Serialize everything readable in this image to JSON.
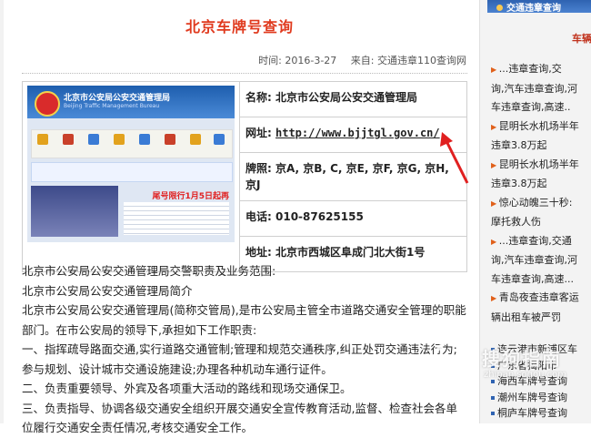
{
  "article": {
    "title": "北京车牌号查询",
    "time": "时间: 2016-3-27",
    "source": "来自: 交通违章110查询网"
  },
  "screenshot": {
    "header_name": "北京市公安局公安交通管理局",
    "header_sub": "Beijing Traffic Management Bureau",
    "red_notice": "尾号限行1月5日起再"
  },
  "info": {
    "name_label": "名称:",
    "name_value": "北京市公安局公安交通管理局",
    "site_label": "网址:",
    "site_value": "http://www.bjjtgl.gov.cn/",
    "plate_label": "牌照:",
    "plate_value": "京A, 京B, C, 京E, 京F, 京G, 京H, 京J",
    "phone_label": "电话:",
    "phone_value": "010-87625155",
    "addr_label": "地址:",
    "addr_value": "北京市西城区阜成门北大街1号"
  },
  "body": [
    "北京市公安局公安交通管理局交警职责及业务范围:",
    "北京市公安局公安交通管理局简介",
    "北京市公安局公安交通管理局(简称交管局),是市公安局主管全市道路交通安全管理的职能部门。在市公安局的领导下,承担如下工作职责:",
    "一、指挥疏导路面交通,实行道路交通管制;管理和规范交通秩序,纠正处罚交通违法行为;参与规划、设计城市交通设施建设;办理各种机动车通行证件。",
    "二、负责重要领导、外宾及各项重大活动的路线和现场交通保卫。",
    "三、负责指导、协调各级交通安全组织开展交通安全宣传教育活动,监督、检查社会各单位履行交通安全责任情况,考核交通安全工作。"
  ],
  "sidebar": {
    "header": "交通违章查询",
    "category": "车辆",
    "items": [
      "...违章查询,交",
      "询,汽车违章查询,河",
      "车违章查询,高速..",
      "昆明长水机场半年",
      "违章3.8万起",
      "昆明长水机场半年",
      "违章3.8万起",
      "惊心动魄三十秒:",
      "摩托救人伤",
      "...违章查询,交通",
      "询,汽车违章查询,河",
      "车违章查询,高速...",
      "青岛夜查违章客运",
      "辆出租车被严罚"
    ],
    "list2": [
      "连云港市新浦区车",
      "广东省揭阳市",
      "海西车牌号查询",
      "潮州车牌号查询",
      "桐庐车牌号查询"
    ]
  },
  "watermark": {
    "text": "搜狗指南",
    "domain": "zhinan.sogou.com"
  }
}
